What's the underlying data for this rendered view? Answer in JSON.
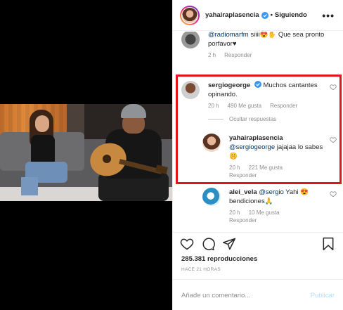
{
  "colors": {
    "highlight": "#e0161b",
    "verified": "#3897f0",
    "link": "#003569",
    "muted": "#8e8e8e",
    "publish": "#b2dffc"
  },
  "header": {
    "username": "yahairaplasencia",
    "separator": "•",
    "follow_status": "Siguiendo",
    "more_icon": "more-dots-icon"
  },
  "comments": [
    {
      "mention": "@radiomarfm",
      "text": " siiii😍✋ Que sea pronto porfavor♥",
      "time": "2 h",
      "reply_label": "Responder"
    },
    {
      "username": "sergiogeorge",
      "text": " Muchos cantantes opinando.",
      "time": "20 h",
      "likes": "490 Me gusta",
      "reply_label": "Responder",
      "hide_replies": "Ocultar respuestas"
    },
    {
      "username": "yahairaplasencia",
      "mention": "@sergiogeorge",
      "text": " jajajaa lo sabes 🤫",
      "time": "20 h",
      "likes": "221 Me gusta",
      "reply_label": "Responder"
    },
    {
      "username": "alei_vela",
      "mention": "@sergio",
      "text": " Yahi 😍 bendiciones🙏",
      "time": "20 h",
      "likes": "10 Me gusta",
      "reply_label": "Responder"
    }
  ],
  "actions": {
    "like_icon": "heart-icon",
    "comment_icon": "comment-icon",
    "share_icon": "share-icon",
    "save_icon": "bookmark-icon",
    "views": "285.381 reproducciones",
    "time_ago": "HACE 21 HORAS"
  },
  "add_comment": {
    "placeholder": "Añade un comentario...",
    "publish_label": "Publicar"
  }
}
